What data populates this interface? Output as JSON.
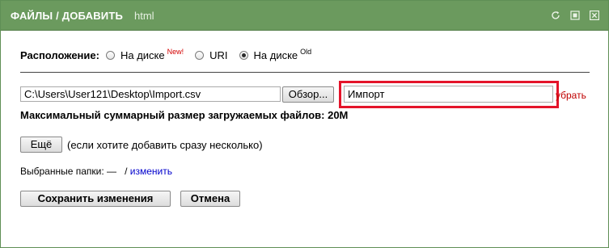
{
  "window": {
    "title": "ФАЙЛЫ / ДОБАВИТЬ",
    "subtitle": "html",
    "icons": [
      "refresh-icon",
      "restore-icon",
      "close-icon"
    ]
  },
  "location": {
    "label": "Расположение:",
    "options": [
      {
        "label": "На диске",
        "badge": "New!",
        "checked": false
      },
      {
        "label": "URI",
        "badge": "",
        "checked": false
      },
      {
        "label": "На диске",
        "badge": "Old",
        "checked": true
      }
    ]
  },
  "file": {
    "path": "C:\\Users\\User121\\Desktop\\Import.csv",
    "browse_label": "Обзор...",
    "name_value": "Импорт",
    "remove_label": "убрать"
  },
  "max_size": {
    "label": "Максимальный суммарный размер загружаемых файлов:",
    "value": "20M"
  },
  "more": {
    "button_label": "Ещё",
    "hint": "(если хотите добавить сразу несколько)"
  },
  "folders": {
    "label": "Выбранные папки:",
    "value": "—",
    "separator": "/",
    "change_label": "изменить"
  },
  "actions": {
    "save_label": "Сохранить изменения",
    "cancel_label": "Отмена"
  },
  "colors": {
    "titlebar": "#6b9a5e",
    "highlight": "#e4142a",
    "new_badge": "#d40000",
    "link": "#0000cc"
  }
}
